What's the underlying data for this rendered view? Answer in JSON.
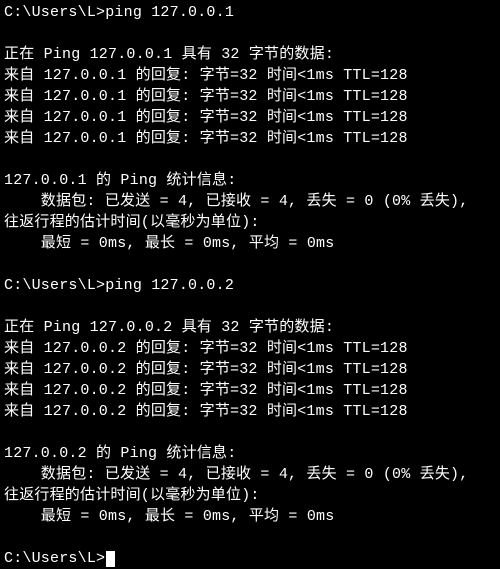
{
  "block1": {
    "prompt": "C:\\Users\\L>ping 127.0.0.1",
    "header": "正在 Ping 127.0.0.1 具有 32 字节的数据:",
    "replies": [
      "来自 127.0.0.1 的回复: 字节=32 时间<1ms TTL=128",
      "来自 127.0.0.1 的回复: 字节=32 时间<1ms TTL=128",
      "来自 127.0.0.1 的回复: 字节=32 时间<1ms TTL=128",
      "来自 127.0.0.1 的回复: 字节=32 时间<1ms TTL=128"
    ],
    "stats_header": "127.0.0.1 的 Ping 统计信息:",
    "stats_packets": "    数据包: 已发送 = 4, 已接收 = 4, 丢失 = 0 (0% 丢失),",
    "rtt_header": "往返行程的估计时间(以毫秒为单位):",
    "rtt_values": "    最短 = 0ms, 最长 = 0ms, 平均 = 0ms"
  },
  "block2": {
    "prompt": "C:\\Users\\L>ping 127.0.0.2",
    "header": "正在 Ping 127.0.0.2 具有 32 字节的数据:",
    "replies": [
      "来自 127.0.0.2 的回复: 字节=32 时间<1ms TTL=128",
      "来自 127.0.0.2 的回复: 字节=32 时间<1ms TTL=128",
      "来自 127.0.0.2 的回复: 字节=32 时间<1ms TTL=128",
      "来自 127.0.0.2 的回复: 字节=32 时间<1ms TTL=128"
    ],
    "stats_header": "127.0.0.2 的 Ping 统计信息:",
    "stats_packets": "    数据包: 已发送 = 4, 已接收 = 4, 丢失 = 0 (0% 丢失),",
    "rtt_header": "往返行程的估计时间(以毫秒为单位):",
    "rtt_values": "    最短 = 0ms, 最长 = 0ms, 平均 = 0ms"
  },
  "final_prompt": "C:\\Users\\L>"
}
